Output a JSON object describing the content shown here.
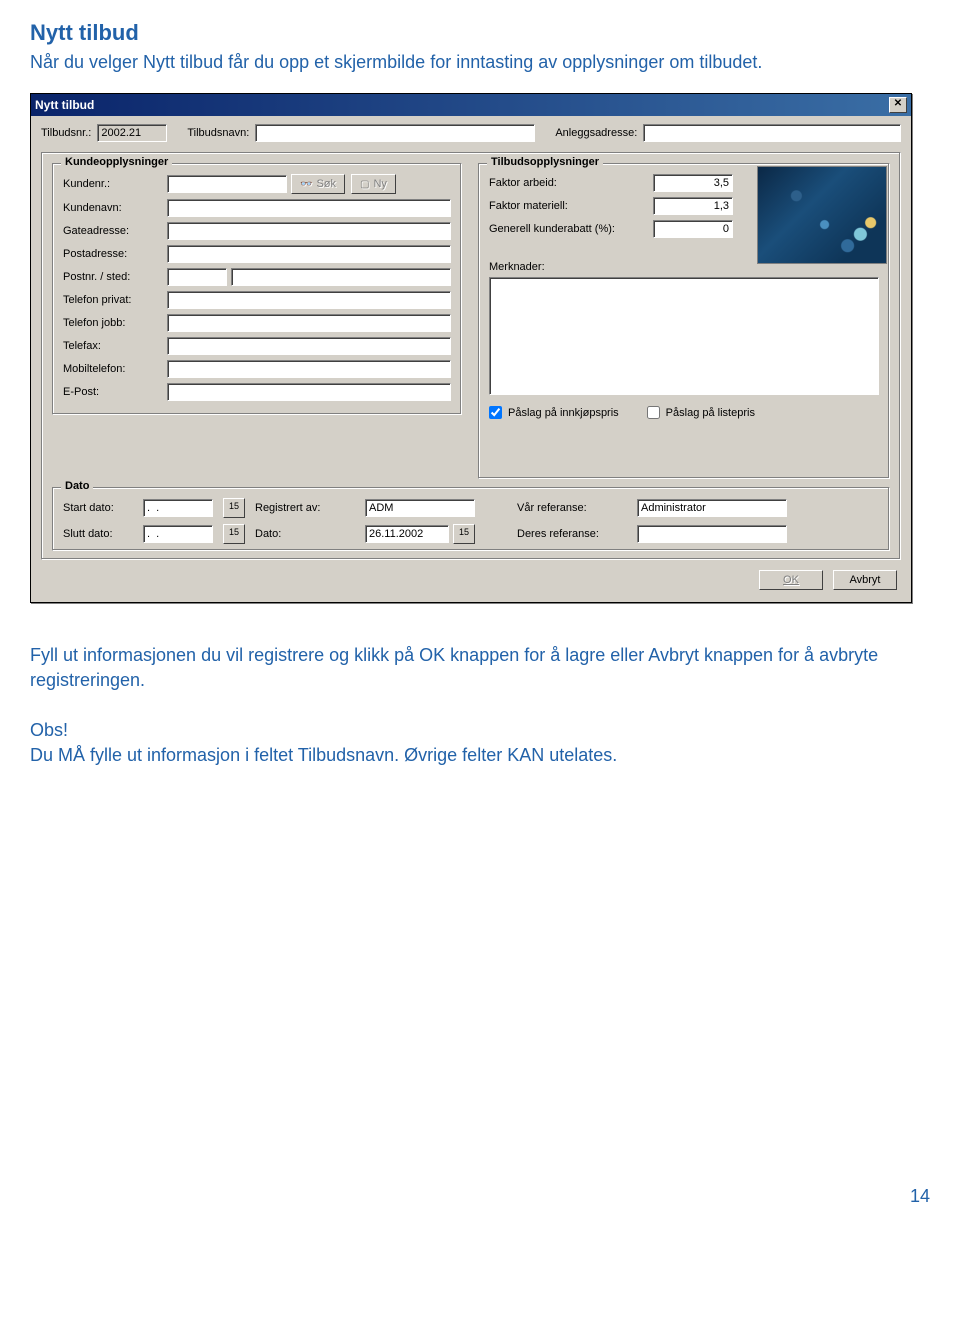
{
  "doc": {
    "title": "Nytt tilbud",
    "intro": "Når du velger Nytt tilbud får du opp et skjermbilde for inntasting av opplysninger om tilbudet.",
    "para2": "Fyll ut informasjonen du vil registrere og klikk på OK knappen for å lagre eller Avbryt knappen for å avbryte registreringen.",
    "para3a": "Obs!",
    "para3b": "Du MÅ fylle ut informasjon i feltet Tilbudsnavn. Øvrige felter KAN utelates.",
    "page_number": "14"
  },
  "dialog": {
    "title": "Nytt tilbud",
    "close_glyph": "✕",
    "top": {
      "tilbudsnr_label": "Tilbudsnr.:",
      "tilbudsnr_value": "2002.21",
      "tilbudsnavn_label": "Tilbudsnavn:",
      "tilbudsnavn_value": "",
      "anleggsadresse_label": "Anleggsadresse:",
      "anleggsadresse_value": ""
    },
    "kunde": {
      "legend": "Kundeopplysninger",
      "kundenr_label": "Kundenr.:",
      "kundenr_value": "",
      "sok_label": "Søk",
      "ny_label": "Ny",
      "kundenavn_label": "Kundenavn:",
      "gateadresse_label": "Gateadresse:",
      "postadresse_label": "Postadresse:",
      "postnr_label": "Postnr. / sted:",
      "telefon_privat_label": "Telefon privat:",
      "telefon_jobb_label": "Telefon jobb:",
      "telefax_label": "Telefax:",
      "mobil_label": "Mobiltelefon:",
      "epost_label": "E-Post:"
    },
    "tilbud": {
      "legend": "Tilbudsopplysninger",
      "faktor_arbeid_label": "Faktor arbeid:",
      "faktor_arbeid_value": "3,5",
      "faktor_materiell_label": "Faktor materiell:",
      "faktor_materiell_value": "1,3",
      "generell_rabatt_label": "Generell kunderabatt (%):",
      "generell_rabatt_value": "0",
      "merknader_label": "Merknader:",
      "merknader_value": "",
      "paslag_innkjop_label": "Påslag på innkjøpspris",
      "paslag_innkjop_checked": true,
      "paslag_listepris_label": "Påslag på listepris",
      "paslag_listepris_checked": false
    },
    "dato": {
      "legend": "Dato",
      "start_label": "Start dato:",
      "start_value": ".  .",
      "slutt_label": "Slutt dato:",
      "slutt_value": ".  .",
      "cal_glyph": "15",
      "registrert_av_label": "Registrert av:",
      "registrert_av_value": "ADM",
      "dato_label": "Dato:",
      "dato_value": "26.11.2002",
      "var_ref_label": "Vår referanse:",
      "var_ref_value": "Administrator",
      "deres_ref_label": "Deres referanse:",
      "deres_ref_value": ""
    },
    "footer": {
      "ok_label": "OK",
      "avbryt_label": "Avbryt"
    }
  }
}
